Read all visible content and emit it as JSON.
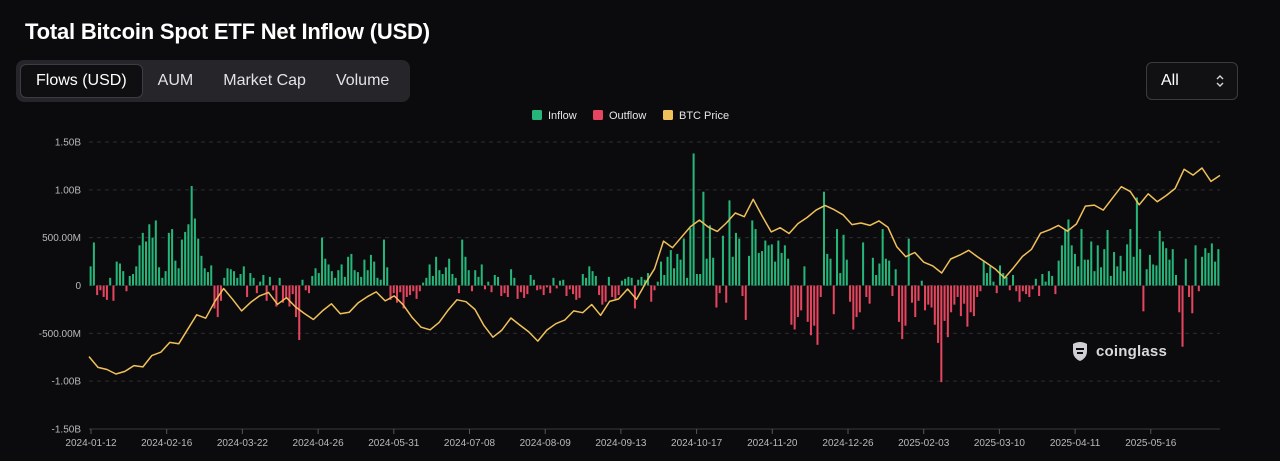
{
  "header": {
    "title": "Total Bitcoin Spot ETF Net Inflow (USD)"
  },
  "tabs": [
    {
      "label": "Flows (USD)",
      "active": true
    },
    {
      "label": "AUM",
      "active": false
    },
    {
      "label": "Market Cap",
      "active": false
    },
    {
      "label": "Volume",
      "active": false
    }
  ],
  "range_select": {
    "value": "All",
    "icon": "chevron-updown-icon"
  },
  "watermark": {
    "text": "coinglass",
    "icon": "coinglass-logo-icon"
  },
  "colors": {
    "inflow": "#26b67a",
    "outflow": "#e5455f",
    "price": "#f0c15b",
    "background": "#0b0b0d",
    "grid": "#2c2c31"
  },
  "chart_data": {
    "type": "bar",
    "title": "Total Bitcoin Spot ETF Net Inflow (USD)",
    "legend": {
      "position": "top-center",
      "entries": [
        "Inflow",
        "Outflow",
        "BTC Price"
      ]
    },
    "grid": true,
    "x_ticks": [
      "2024-01-12",
      "2024-02-16",
      "2024-03-22",
      "2024-04-26",
      "2024-05-31",
      "2024-07-08",
      "2024-08-09",
      "2024-09-13",
      "2024-10-17",
      "2024-11-20",
      "2024-12-26",
      "2025-02-03",
      "2025-03-10",
      "2025-04-11",
      "2025-05-16"
    ],
    "y_ticks": [
      {
        "value": 1500,
        "label": "1.50B"
      },
      {
        "value": 1000,
        "label": "1.00B"
      },
      {
        "value": 500,
        "label": "500.00M"
      },
      {
        "value": 0,
        "label": "0"
      },
      {
        "value": -500,
        "label": "-500.00M"
      },
      {
        "value": -1000,
        "label": "-1.00B"
      },
      {
        "value": -1500,
        "label": "-1.50B"
      }
    ],
    "ylim": [
      -1500,
      1500
    ],
    "y_unit": "USD millions",
    "series": [
      {
        "name": "Inflow/Outflow",
        "values_in_millions": [
          200,
          450,
          -100,
          -50,
          -120,
          -150,
          80,
          -160,
          250,
          230,
          150,
          -60,
          100,
          120,
          200,
          420,
          550,
          460,
          640,
          500,
          680,
          190,
          80,
          150,
          550,
          590,
          260,
          180,
          480,
          560,
          640,
          1040,
          700,
          490,
          310,
          180,
          140,
          210,
          -240,
          -330,
          -160,
          80,
          180,
          170,
          150,
          80,
          120,
          200,
          -120,
          130,
          80,
          -80,
          40,
          110,
          -160,
          90,
          -50,
          -220,
          80,
          -180,
          -130,
          -220,
          -90,
          -330,
          -570,
          60,
          -50,
          -80,
          100,
          180,
          130,
          500,
          280,
          220,
          150,
          80,
          160,
          220,
          90,
          300,
          330,
          160,
          140,
          90,
          270,
          160,
          320,
          250,
          80,
          60,
          480,
          190,
          -150,
          -80,
          -180,
          -70,
          -240,
          -120,
          -100,
          -60,
          -140,
          -60,
          30,
          80,
          220,
          100,
          300,
          160,
          120,
          190,
          280,
          120,
          80,
          -80,
          480,
          300,
          160,
          -60,
          160,
          90,
          220,
          -40,
          40,
          -70,
          110,
          90,
          -110,
          -80,
          -120,
          170,
          80,
          -140,
          -70,
          -130,
          -90,
          110,
          60,
          -50,
          -40,
          -100,
          -20,
          -80,
          80,
          -30,
          50,
          60,
          -110,
          -40,
          -90,
          -150,
          -130,
          120,
          80,
          200,
          150,
          100,
          -100,
          -200,
          -170,
          90,
          -120,
          -140,
          -100,
          50,
          70,
          90,
          80,
          -240,
          60,
          90,
          60,
          130,
          -170,
          -50,
          40,
          250,
          110,
          300,
          370,
          180,
          330,
          270,
          490,
          80,
          600,
          1380,
          120,
          120,
          980,
          280,
          630,
          290,
          -230,
          -80,
          520,
          -180,
          890,
          300,
          550,
          490,
          -110,
          -360,
          310,
          680,
          590,
          340,
          360,
          470,
          420,
          430,
          250,
          470,
          340,
          420,
          280,
          -410,
          -460,
          -330,
          -260,
          200,
          -380,
          -520,
          -420,
          -620,
          -120,
          980,
          330,
          280,
          -300,
          590,
          130,
          530,
          270,
          -170,
          -460,
          -330,
          -280,
          450,
          -120,
          -190,
          290,
          110,
          230,
          590,
          280,
          260,
          -110,
          170,
          -380,
          -560,
          -420,
          490,
          -180,
          -330,
          -160,
          50,
          -260,
          -200,
          -230,
          -410,
          -600,
          -1010,
          -370,
          -540,
          -280,
          -200,
          -120,
          -320,
          -190,
          -430,
          -280,
          -320,
          -120,
          -60,
          260,
          130,
          200,
          40,
          -80,
          210,
          130,
          90,
          -50,
          110,
          -60,
          -170,
          -60,
          -90,
          -120,
          -40,
          70,
          -110,
          120,
          40,
          150,
          100,
          -90,
          260,
          420,
          590,
          690,
          420,
          330,
          200,
          590,
          270,
          270,
          460,
          150,
          420,
          190,
          380,
          580,
          100,
          350,
          200,
          310,
          150,
          430,
          590,
          300,
          920,
          380,
          -270,
          170,
          320,
          220,
          210,
          570,
          460,
          390,
          270,
          380,
          110,
          -280,
          -640,
          280,
          -120,
          -290,
          420,
          -60,
          300,
          390,
          340,
          440,
          250,
          380
        ]
      },
      {
        "name": "BTC Price",
        "values": [
          46600,
          42500,
          41700,
          40000,
          41000,
          43200,
          42700,
          47000,
          48300,
          52000,
          51500,
          57000,
          62500,
          61200,
          67500,
          72500,
          68400,
          64000,
          67200,
          69700,
          71000,
          66500,
          69000,
          65500,
          63000,
          60700,
          64000,
          66700,
          62900,
          63500,
          67100,
          69400,
          71200,
          67800,
          69700,
          66300,
          61500,
          57800,
          56800,
          59600,
          64200,
          68200,
          67500,
          64500,
          58400,
          54000,
          56700,
          61300,
          58600,
          56000,
          52500,
          56700,
          59100,
          60500,
          64000,
          63300,
          66400,
          62300,
          67600,
          68500,
          72300,
          68400,
          74500,
          80000,
          90500,
          88000,
          92000,
          96000,
          98500,
          95800,
          94200,
          97400,
          101200,
          99800,
          106400,
          100000,
          94000,
          95600,
          93400,
          97200,
          99500,
          102300,
          104100,
          102500,
          100500,
          96800,
          97400,
          96500,
          98200,
          95800,
          88300,
          84600,
          86200,
          82500,
          81100,
          78400,
          83700,
          85200,
          87000,
          84500,
          82200,
          79800,
          76500,
          80400,
          84700,
          87400,
          93500,
          94800,
          96500,
          94300,
          97000,
          103800,
          104200,
          102300,
          106800,
          111200,
          109400,
          104300,
          108500,
          105500,
          107800,
          110500,
          117800,
          115600,
          118300,
          113200,
          115500
        ]
      }
    ]
  }
}
